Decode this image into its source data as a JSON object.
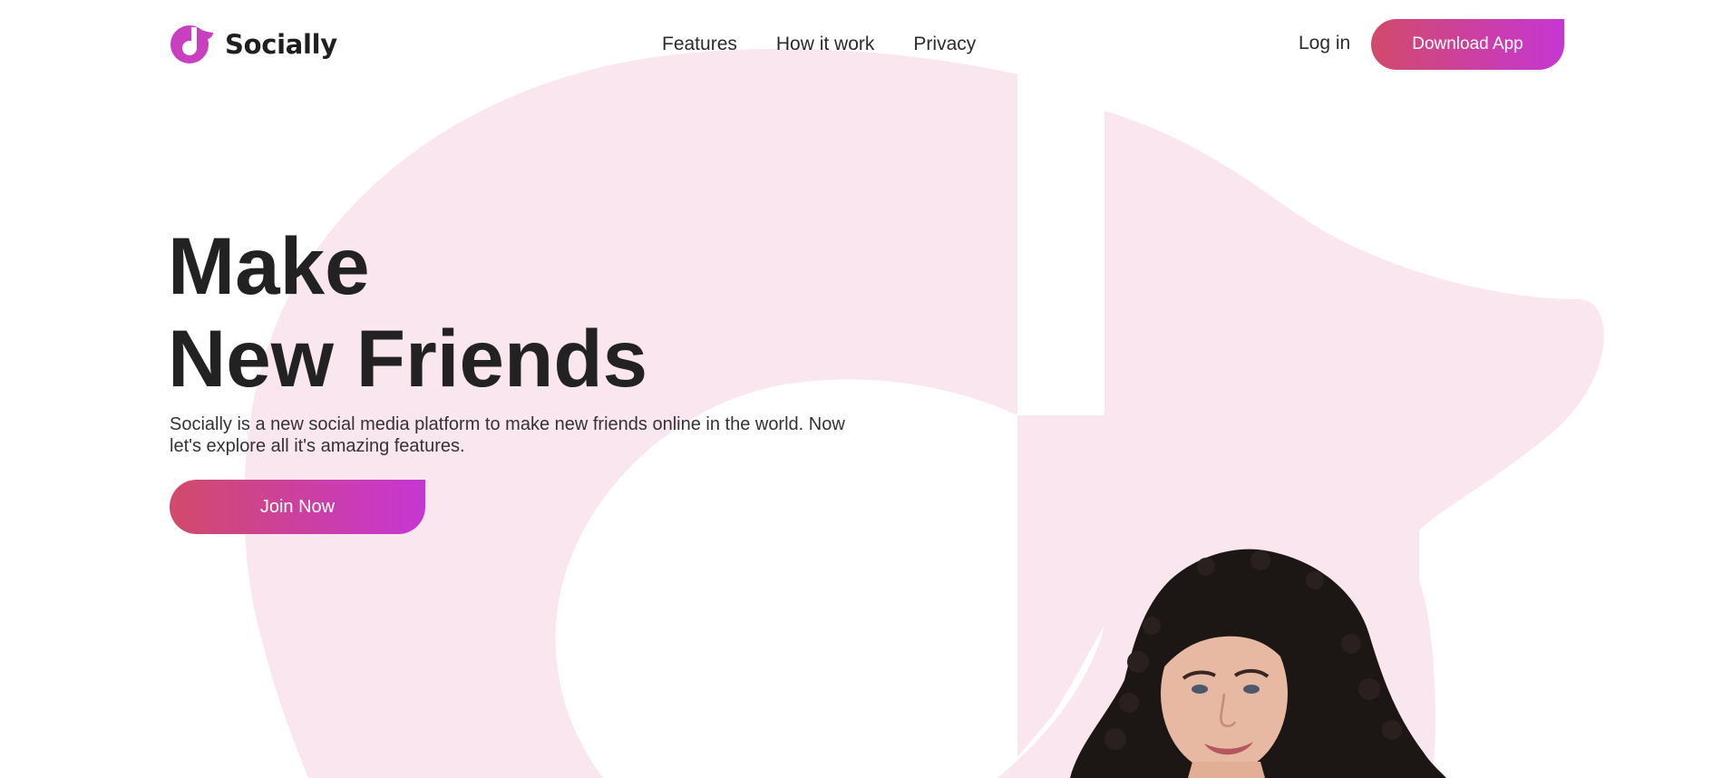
{
  "brand": {
    "name": "Socially",
    "logo_icon": "music-note-icon",
    "accent_start": "#d24a6a",
    "accent_end": "#c636d3",
    "shape_color": "#fae6ef"
  },
  "nav": {
    "items": [
      {
        "label": "Features"
      },
      {
        "label": "How it work"
      },
      {
        "label": "Privacy"
      }
    ],
    "login_label": "Log in",
    "download_label": "Download App"
  },
  "hero": {
    "title_line1": "Make",
    "title_line2": "New Friends",
    "description": "Socially is a new social media platform to make new friends online in the world. Now let's explore all it's amazing features.",
    "cta_label": "Join Now"
  },
  "portrait": {
    "subject": "woman-portrait"
  }
}
